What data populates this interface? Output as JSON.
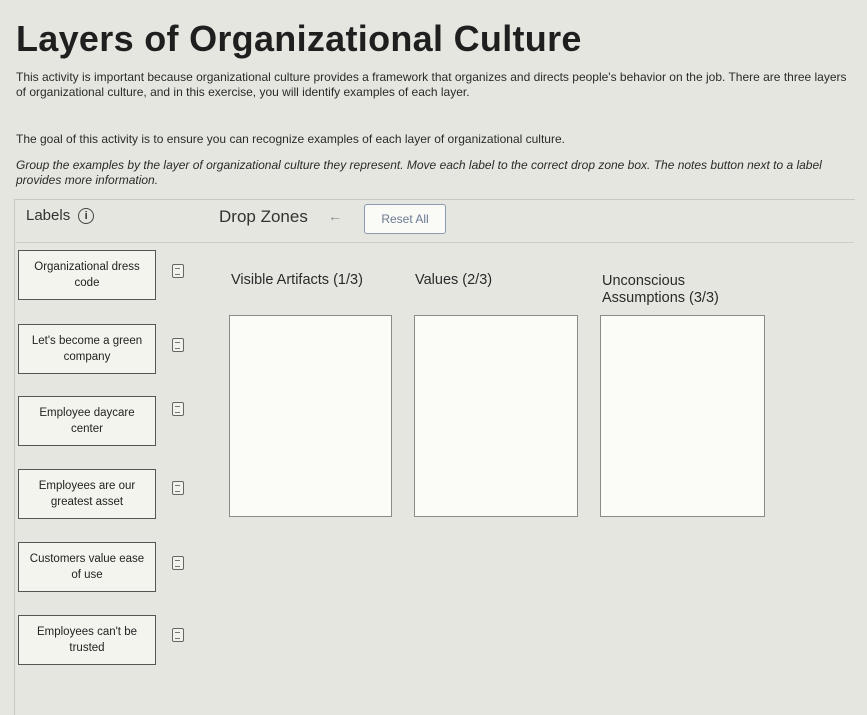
{
  "title": "Layers of Organizational Culture",
  "paragraphs": [
    "This activity is important because organizational culture provides a framework that organizes and directs people's behavior on the job. There are three layers of organizational culture, and in this exercise, you will identify examples of each layer.",
    "The goal of this activity is to ensure you can recognize examples of each layer of organizational culture.",
    "Group the examples by the layer of organizational culture they represent. Move each label to the correct drop zone box. The notes button next to a label provides more information."
  ],
  "labels_header": "Labels",
  "drop_zones_header": "Drop Zones",
  "reset_label": "Reset All",
  "labels": [
    "Organizational dress code",
    "Let's become a green company",
    "Employee daycare center",
    "Employees are our greatest asset",
    "Customers value ease of use",
    "Employees can't be trusted"
  ],
  "zones": [
    "Visible Artifacts (1/3)",
    "Values (2/3)",
    "Unconscious Assumptions (3/3)"
  ],
  "icons": {
    "info": "info-icon",
    "back": "back-arrow-icon",
    "note": "note-icon"
  }
}
